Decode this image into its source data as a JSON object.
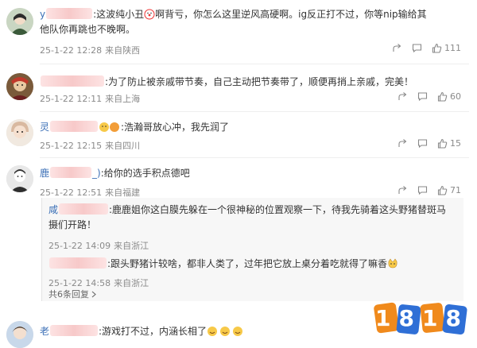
{
  "comments": [
    {
      "name_prefix": "y",
      "text": ":这波纯小丑",
      "text2": "啊背亏，你怎么这里逆风高硬啊。ig反正打不过，你等nip输给其",
      "text3": "他队你再跳也不晚啊。",
      "date": "25-1-22 12:28",
      "location": "来自陕西",
      "likes": "111"
    },
    {
      "text": ":为了防止被亲戚带节奏，自己主动把节奏带了，顺便再捎上亲戚，完美！",
      "date": "25-1-22 12:11",
      "location": "来自上海",
      "likes": "60"
    },
    {
      "name_prefix": "灵",
      "text": ":浩瀚哥放心冲，我先润了",
      "date": "25-1-22 12:15",
      "location": "来自四川",
      "likes": "15"
    },
    {
      "name_prefix": "鹿",
      "name_suffix": "_)",
      "text": ":给你的选手积点德吧",
      "date": "25-1-22 12:51",
      "location": "来自福建",
      "likes": "71"
    },
    {
      "name_prefix": "老",
      "text": ":游戏打不过，内涵长相了"
    }
  ],
  "replies": [
    {
      "name_prefix": "咸",
      "text": ":鹿鹿姐你这白膜先躲在一个很神秘的位置观察一下，待我先骑着这头野猪替斑马",
      "text2": "摄们开路！",
      "date": "25-1-22 14:09",
      "location": "来自浙江"
    },
    {
      "text": ":跟头野猪计较啥，都非人类了，过年把它放上桌分着吃就得了嘛香",
      "date": "25-1-22 14:58",
      "location": "来自浙江"
    }
  ],
  "more_replies": "共6条回复",
  "logo_text": "1818",
  "colors": {
    "username": "#3b6fb6",
    "meta": "#8a8a8a",
    "reply_bg": "#f7f7f7",
    "logo_orange": "#f08a1c"
  }
}
